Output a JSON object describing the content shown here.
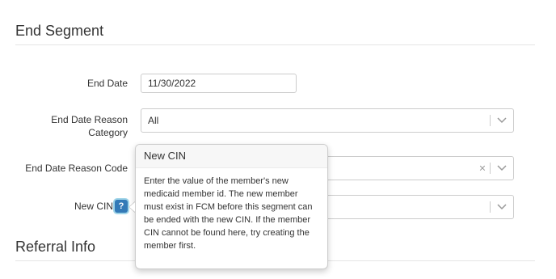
{
  "end_segment": {
    "title": "End Segment",
    "end_date": {
      "label": "End Date",
      "value": "11/30/2022"
    },
    "end_date_reason_category": {
      "label_line1": "End Date Reason",
      "label_line2": "Category",
      "value": "All"
    },
    "end_date_reason_code": {
      "label": "End Date Reason Code",
      "value": ""
    },
    "new_cin": {
      "label": "New CIN",
      "value": ""
    }
  },
  "help_icon": {
    "glyph": "?"
  },
  "popover": {
    "title": "New CIN",
    "text": "Enter the value of the member's new medicaid member id. The new member must exist in FCM before this segment can be ended with the new CIN. If the member CIN cannot be found here, try creating the member first."
  },
  "referral_info": {
    "title": "Referral Info"
  },
  "icons": {
    "chevron": "chevron-down-icon",
    "clear": "clear-icon",
    "help": "help-icon"
  }
}
